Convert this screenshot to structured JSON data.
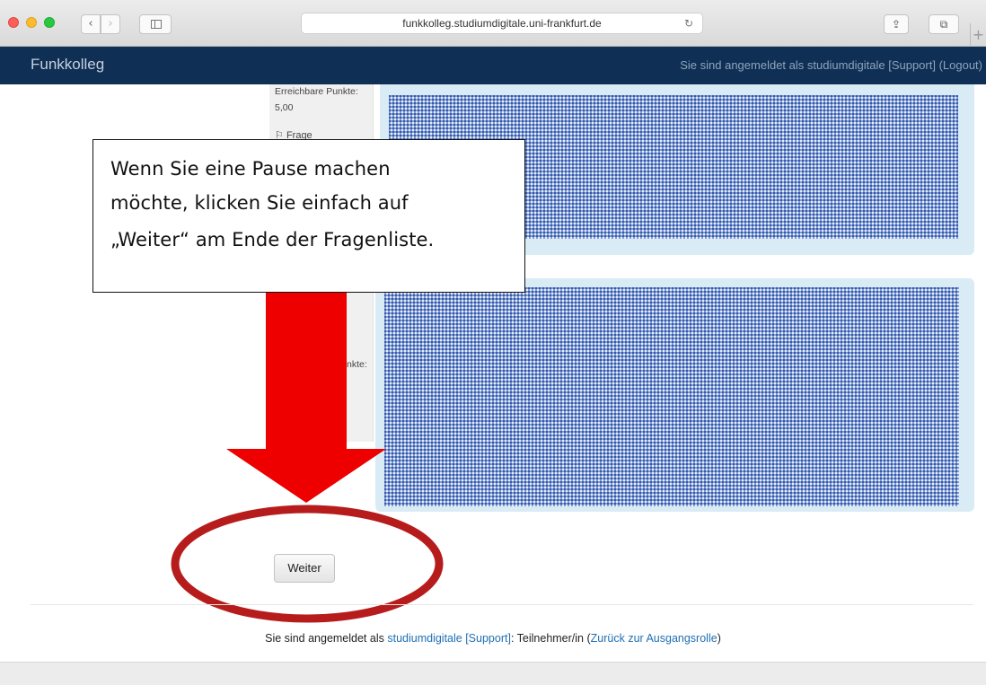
{
  "browser": {
    "url": "funkkolleg.studiumdigitale.uni-frankfurt.de",
    "back_glyph": "‹",
    "forward_glyph": "›",
    "reload_glyph": "↻",
    "share_glyph": "⇪",
    "tabs_glyph": "⧉",
    "newtab_glyph": "+"
  },
  "header": {
    "brand": "Funkkolleg",
    "login_text": "Sie sind angemeldet als studiumdigitale [Support] (Logout)",
    "background": "#0f2f55"
  },
  "question_info": {
    "points_label": "Erreichbare Punkte:",
    "points_value": "5,00",
    "flag_label": "Frage",
    "points_label_partial": "nkte:"
  },
  "callout": {
    "lines": [
      "Wenn Sie eine Pause machen",
      "möchte, klicken Sie einfach auf",
      "„Weiter“ am Ende der Fragenliste."
    ]
  },
  "button": {
    "label": "Weiter"
  },
  "footer": {
    "prefix": "Sie sind angemeldet als ",
    "user_link": "studiumdigitale [Support]",
    "middle": ": Teilnehmer/in (",
    "return_link": "Zurück zur Ausgangsrolle",
    "suffix": ")"
  },
  "annotation_colors": {
    "arrow": "#ee0000",
    "ellipse": "#b71c1c"
  }
}
